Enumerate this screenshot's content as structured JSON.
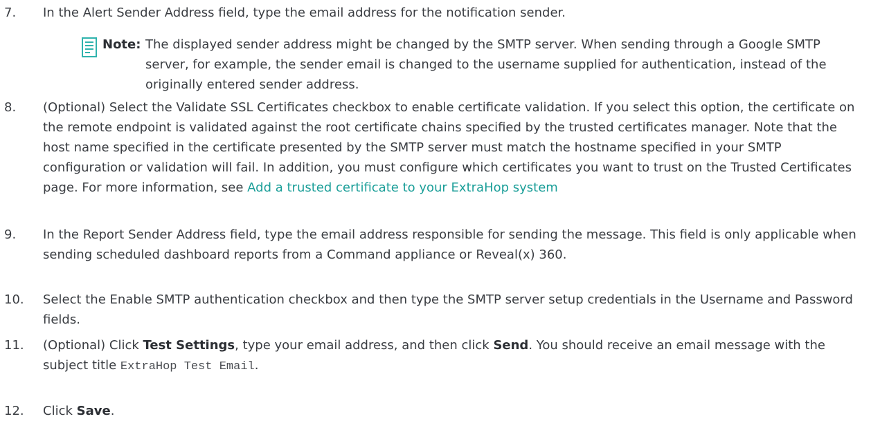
{
  "steps": [
    {
      "num": "7.",
      "text": "In the Alert Sender Address field, type the email address for the notification sender."
    },
    {
      "num": "8.",
      "text": "(Optional) Select the Validate SSL Certificates checkbox to enable certificate validation. If you select this option, the certificate on the remote endpoint is validated against the root certificate chains specified by the trusted certificates manager. Note that the host name specified in the certificate presented by the SMTP server must match the hostname specified in your SMTP configuration or validation will fail. In addition, you must configure which certificates you want to trust on the Trusted Certificates page. For more information, see ",
      "link": "Add a trusted certificate to your ExtraHop system"
    },
    {
      "num": "9.",
      "text": "In the Report Sender Address field, type the email address responsible for sending the message. This field is only applicable when sending scheduled dashboard reports from a Command appliance or Reveal(x) 360."
    },
    {
      "num": "10.",
      "text": "Select the Enable SMTP authentication checkbox and then type the SMTP server setup credentials in the Username and Password fields."
    },
    {
      "num": "11.",
      "pre": "(Optional) Click ",
      "bold1": "Test Settings",
      "mid": ", type your email address, and then click ",
      "bold2": "Send",
      "post": ". You should receive an email message with the subject title ",
      "code": "ExtraHop Test Email",
      "end": "."
    },
    {
      "num": "12.",
      "pre": "Click ",
      "bold": "Save",
      "post": "."
    }
  ],
  "note": {
    "label": "Note:",
    "text": "The displayed sender address might be changed by the SMTP server. When sending through a Google SMTP server, for example, the sender email is changed to the username supplied for authentication, instead of the originally entered sender address.",
    "icon": "note-icon"
  },
  "colors": {
    "text": "#3a3d42",
    "link": "#1a9e98",
    "icon": "#2fb3ad"
  }
}
